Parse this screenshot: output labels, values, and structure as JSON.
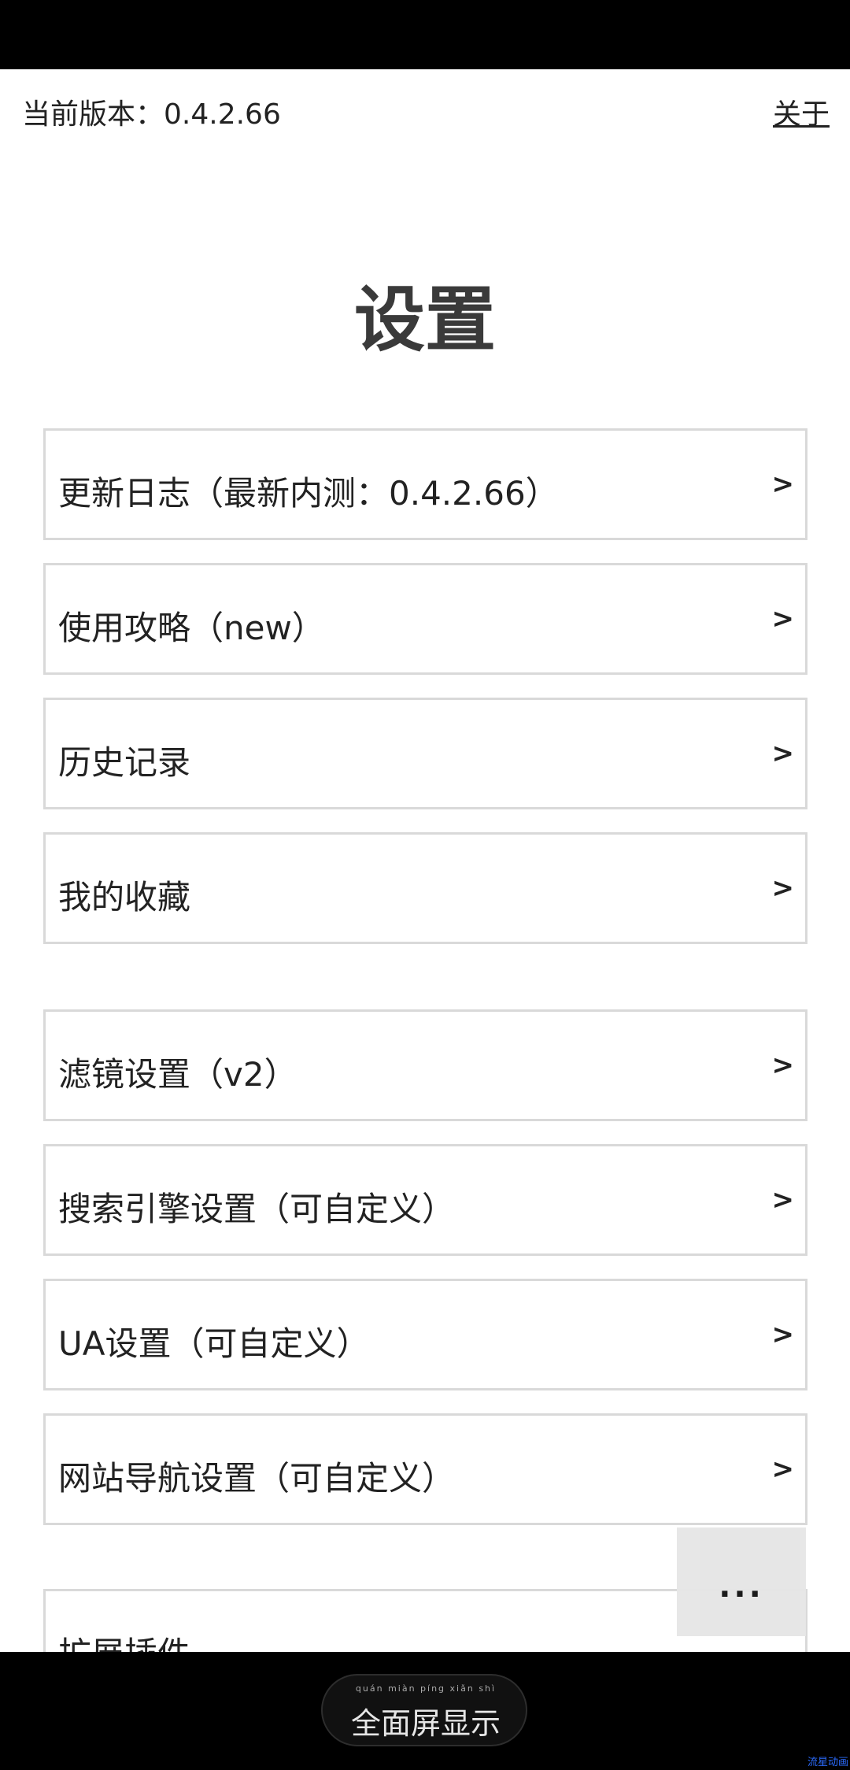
{
  "header": {
    "version_text": "当前版本：0.4.2.66",
    "about_link": "关于"
  },
  "page_title": "设置",
  "menu_group1": [
    {
      "label": "更新日志（最新内测：0.4.2.66）",
      "chevron": ">"
    },
    {
      "label": "使用攻略（new）",
      "chevron": ">"
    },
    {
      "label": "历史记录",
      "chevron": ">"
    },
    {
      "label": "我的收藏",
      "chevron": ">"
    }
  ],
  "menu_group2": [
    {
      "label": "滤镜设置（v2）",
      "chevron": ">"
    },
    {
      "label": "搜索引擎设置（可自定义）",
      "chevron": ">"
    },
    {
      "label": "UA设置（可自定义）",
      "chevron": ">"
    },
    {
      "label": "网站导航设置（可自定义）",
      "chevron": ">"
    },
    {
      "label": "扩展插件",
      "chevron": ""
    }
  ],
  "float_button": {
    "dots": "···"
  },
  "bottom_bar": {
    "pinyin": "quán miàn píng xiǎn shì",
    "label": "全面屏显示",
    "corner": "流星动画"
  }
}
